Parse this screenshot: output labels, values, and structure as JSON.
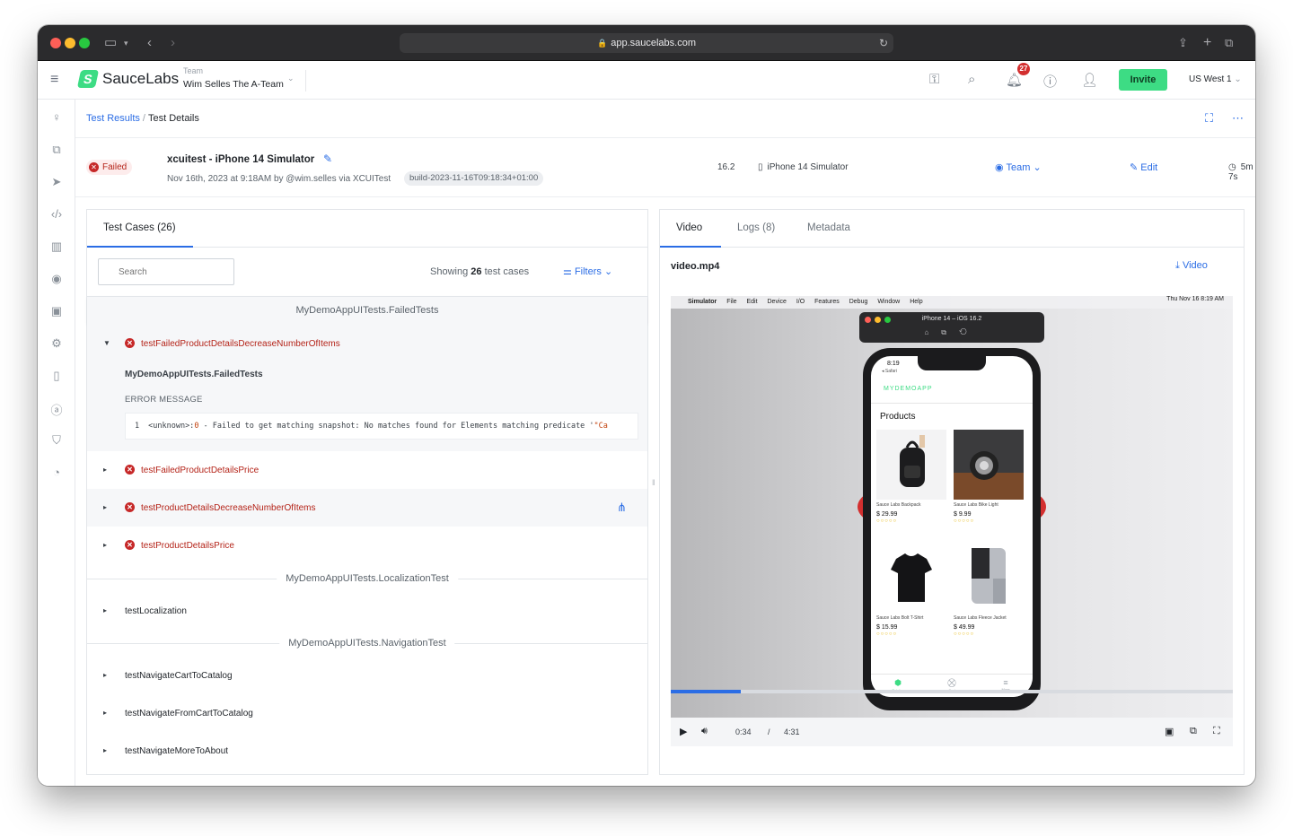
{
  "browser": {
    "url": "app.saucelabs.com"
  },
  "header": {
    "logo_text": "SauceLabs",
    "team_label": "Team",
    "team_name": "Wim Selles The A-Team",
    "notifications_count": "27",
    "invite_label": "Invite",
    "region": "US West 1"
  },
  "breadcrumb": {
    "parent": "Test Results",
    "separator": "/",
    "current": "Test Details"
  },
  "test": {
    "status": "Failed",
    "title": "xcuitest - iPhone 14 Simulator",
    "subtitle": "Nov 16th, 2023 at 9:18AM by @wim.selles via XCUITest",
    "build": "build-2023-11-16T09:18:34+01:00",
    "os_version": "16.2",
    "device": "iPhone 14 Simulator",
    "visibility": "Team",
    "edit_label": "Edit",
    "duration": "5m 7s"
  },
  "test_cases": {
    "tab_label": "Test Cases (26)",
    "search_placeholder": "Search",
    "showing_prefix": "Showing",
    "showing_count": "26",
    "showing_suffix": "test cases",
    "filters_label": "Filters",
    "groups": [
      "MyDemoAppUITests.FailedTests",
      "MyDemoAppUITests.LocalizationTest",
      "MyDemoAppUITests.NavigationTest"
    ],
    "expanded": {
      "name": "testFailedProductDetailsDecreaseNumberOfItems",
      "class": "MyDemoAppUITests.FailedTests",
      "error_label": "ERROR MESSAGE",
      "line_no": "1",
      "error_pre": "<unknown>:",
      "error_num": "0",
      "error_text": " - Failed to get matching snapshot: No matches found for Elements matching predicate '",
      "error_tail": "\"Ca"
    },
    "failed_items": [
      "testFailedProductDetailsPrice",
      "testProductDetailsDecreaseNumberOfItems",
      "testProductDetailsPrice"
    ],
    "localization_items": [
      "testLocalization"
    ],
    "navigation_items": [
      "testNavigateCartToCatalog",
      "testNavigateFromCartToCatalog",
      "testNavigateMoreToAbout"
    ]
  },
  "right_panel": {
    "tabs": [
      "Video",
      "Logs (8)",
      "Metadata"
    ],
    "video_filename": "video.mp4",
    "download_label": "Video",
    "player": {
      "current_time": "0:34",
      "separator": "/",
      "total_time": "4:31",
      "progress_fraction": 0.125
    },
    "simulator": {
      "menu": [
        "Simulator",
        "File",
        "Edit",
        "Device",
        "I/O",
        "Features",
        "Debug",
        "Window",
        "Help"
      ],
      "clock": "Thu Nov 16  8:19 AM",
      "window_title": "iPhone 14 – iOS 16.2",
      "phone_time": "8:19",
      "phone_back": "◂ Safari",
      "app_brand": "MYDEMOAPP",
      "products_title": "Products",
      "products": [
        {
          "name": "Sauce Labs Backpack",
          "price": "$ 29.99"
        },
        {
          "name": "Sauce Labs Bike Light",
          "price": "$ 9.99"
        },
        {
          "name": "Sauce Labs Bolt T-Shirt",
          "price": "$ 15.99"
        },
        {
          "name": "Sauce Labs Fleece Jacket",
          "price": "$ 49.99"
        }
      ],
      "tabbar": [
        "Catalog",
        "Cart",
        "More"
      ]
    }
  }
}
